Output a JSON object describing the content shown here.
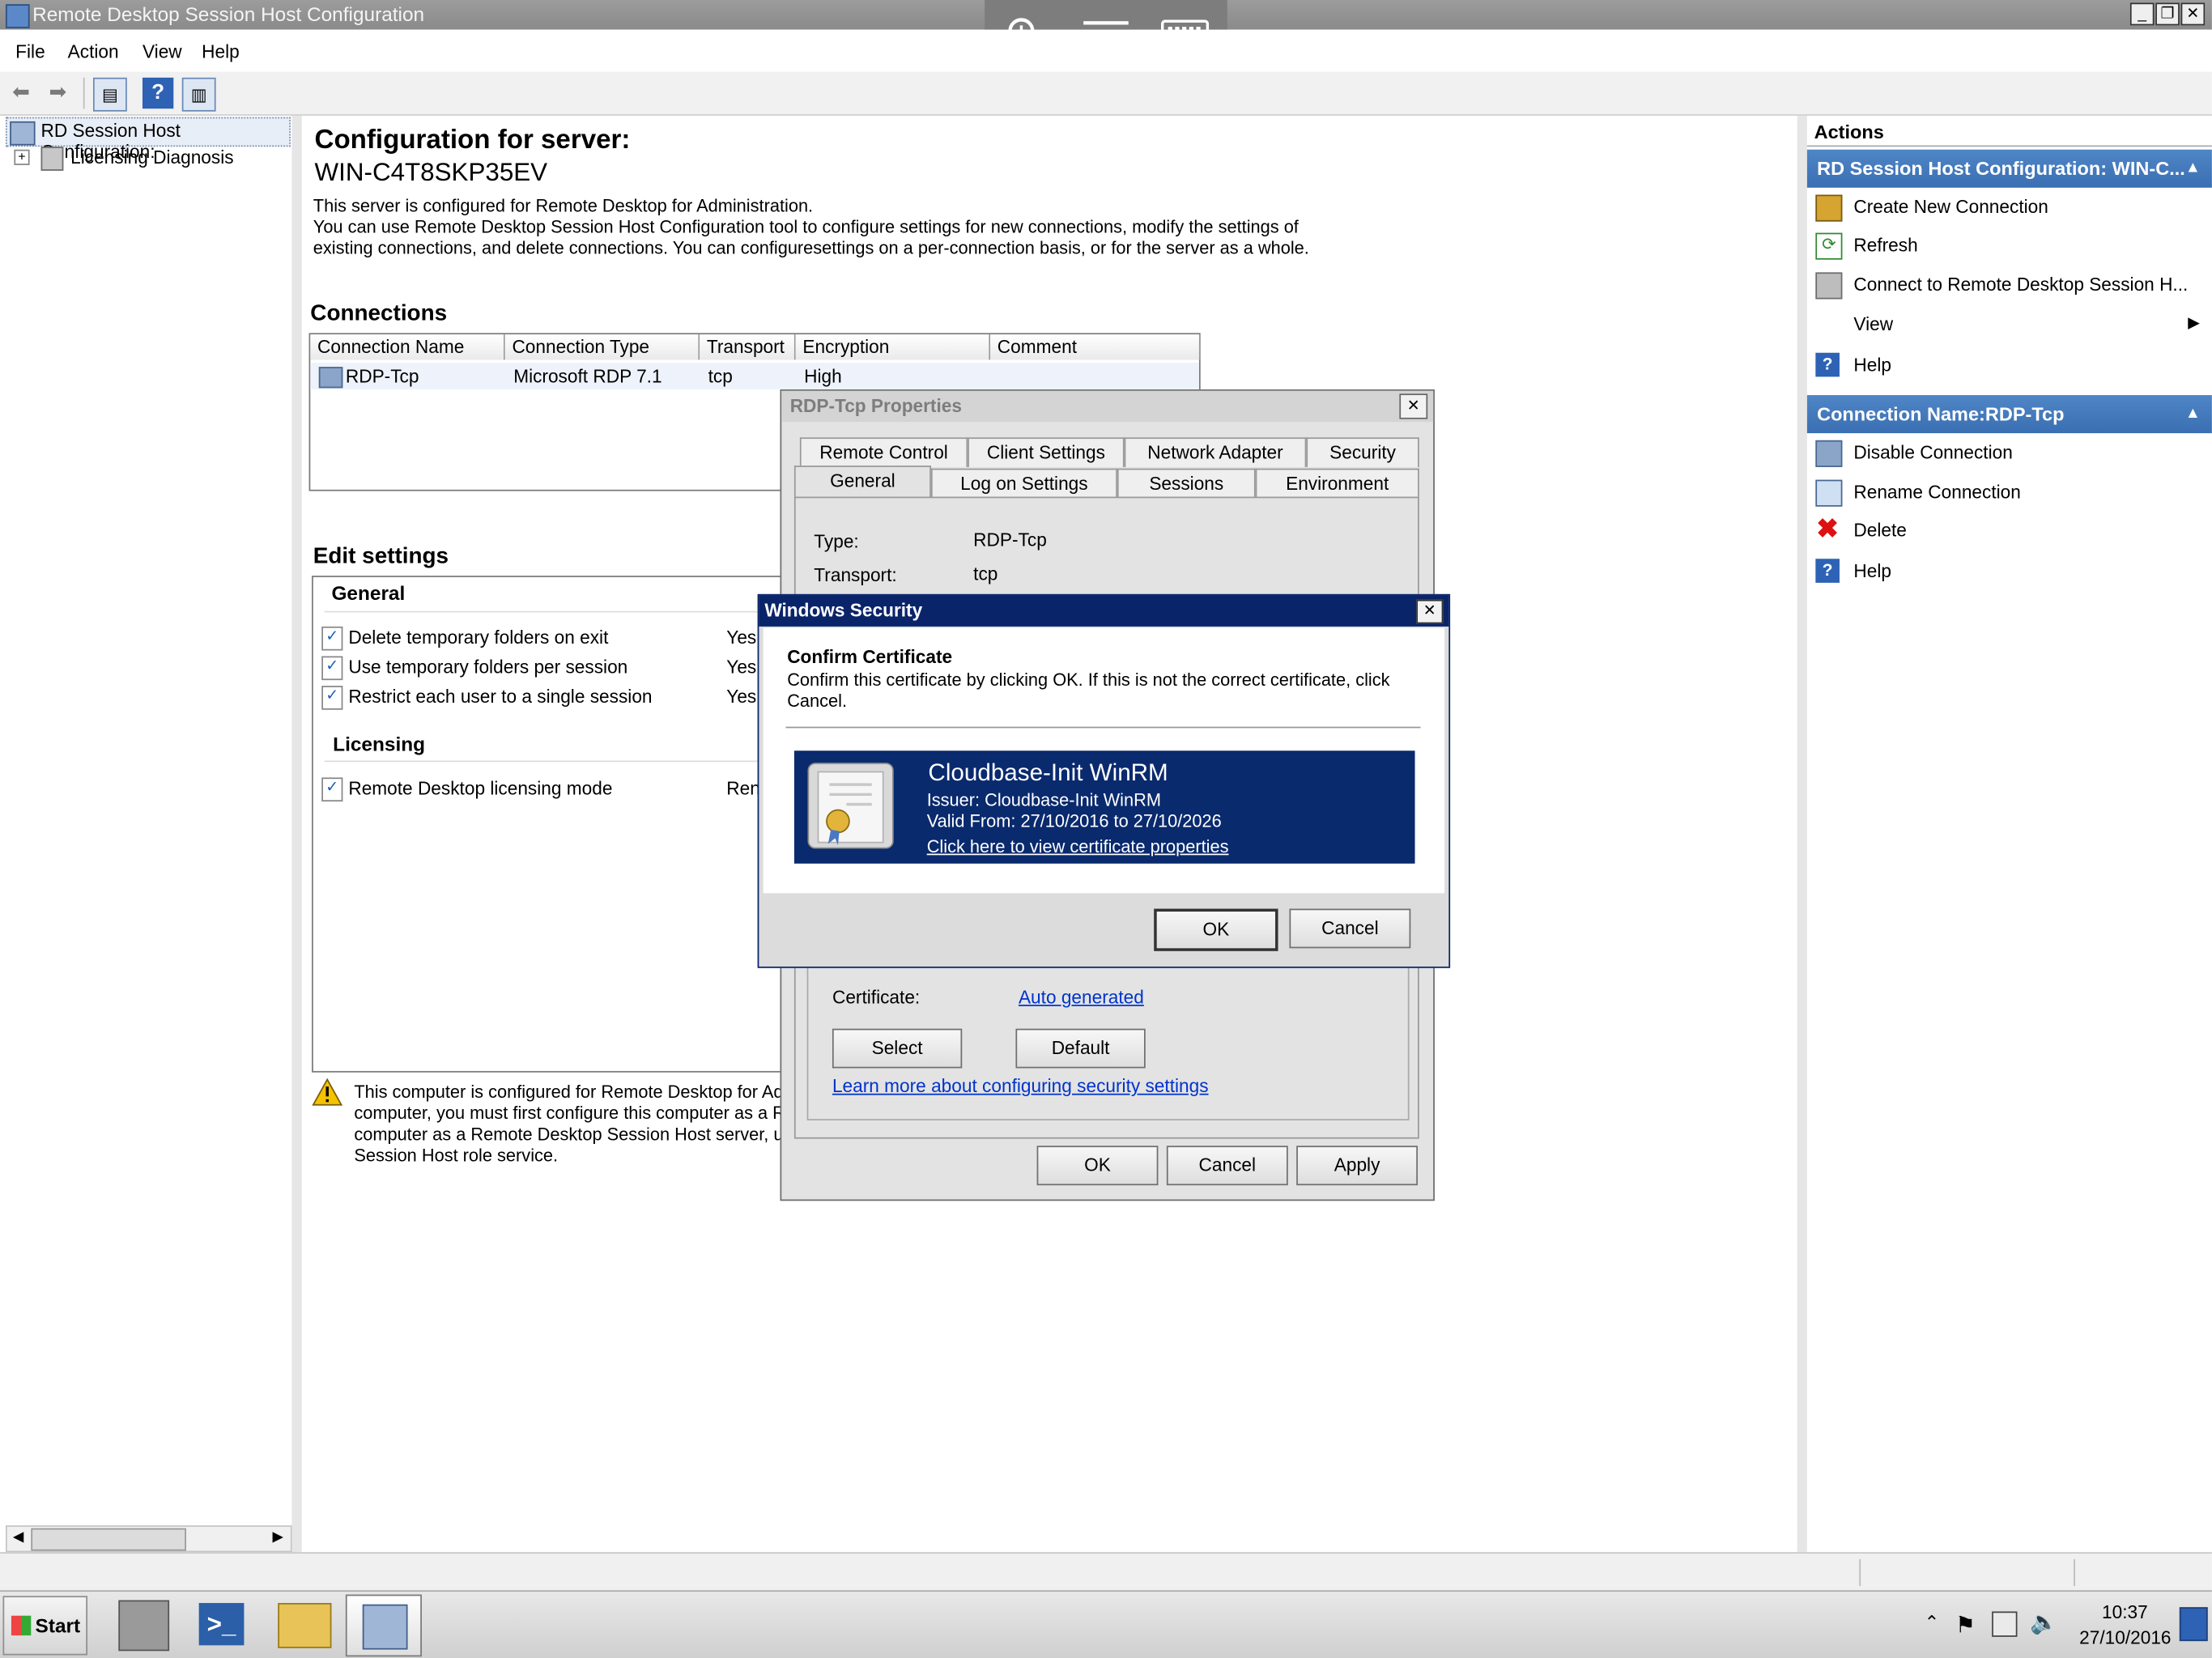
{
  "window": {
    "title": "Remote Desktop Session Host Configuration"
  },
  "menu": [
    "File",
    "Action",
    "View",
    "Help"
  ],
  "tree": {
    "root": "RD Session Host Configuration:",
    "child": "Licensing Diagnosis"
  },
  "main": {
    "title": "Configuration for server:",
    "server": "WIN-C4T8SKP35EV",
    "desc1": "This server is configured for Remote Desktop for Administration.",
    "desc2": "You can use Remote Desktop Session Host Configuration tool to configure settings for new connections, modify the settings of",
    "desc3": "existing connections, and delete connections. You can configuresettings on a per-connection basis, or for the server as a whole.",
    "connections_heading": "Connections",
    "columns": [
      "Connection Name",
      "Connection Type",
      "Transport",
      "Encryption",
      "Comment"
    ],
    "row": {
      "name": "RDP-Tcp",
      "type": "Microsoft RDP 7.1",
      "transport": "tcp",
      "encryption": "High",
      "comment": ""
    },
    "edit_heading": "Edit settings",
    "general": "General",
    "settings": [
      {
        "label": "Delete temporary folders on exit",
        "value": "Yes"
      },
      {
        "label": "Use temporary folders per session",
        "value": "Yes"
      },
      {
        "label": "Restrict each user to a single session",
        "value": "Yes"
      }
    ],
    "licensing": "Licensing",
    "licensing_setting": {
      "label": "Remote Desktop licensing mode",
      "value": "Ren"
    },
    "warning1": "This computer is configured for Remote Desktop for Adn",
    "warning2": "computer, you must first configure this computer as a Re",
    "warning3": "computer as a Remote Desktop Session Host server, us",
    "warning4": "Session Host role service."
  },
  "actions": {
    "title": "Actions",
    "section1": "RD Session Host Configuration: WIN-C...",
    "items1": [
      "Create New Connection",
      "Refresh",
      "Connect to Remote Desktop Session H...",
      "View",
      "Help"
    ],
    "section2": "Connection Name:RDP-Tcp",
    "items2": [
      "Disable Connection",
      "Rename Connection",
      "Delete",
      "Help"
    ]
  },
  "props": {
    "title": "RDP-Tcp Properties",
    "tabs_row1": [
      "Remote Control",
      "Client Settings",
      "Network Adapter",
      "Security"
    ],
    "tabs_row2": [
      "General",
      "Log on Settings",
      "Sessions",
      "Environment"
    ],
    "type_label": "Type:",
    "type_value": "RDP-Tcp",
    "transport_label": "Transport:",
    "transport_value": "tcp",
    "cert_label": "Certificate:",
    "cert_value": "Auto generated",
    "select": "Select",
    "default": "Default",
    "learn": "Learn more about configuring security settings",
    "ok": "OK",
    "cancel": "Cancel",
    "apply": "Apply"
  },
  "security": {
    "title": "Windows Security",
    "heading": "Confirm Certificate",
    "text1": "Confirm this certificate by clicking OK. If this is not the correct certificate, click",
    "text2": "Cancel.",
    "cert_name": "Cloudbase-Init WinRM",
    "issuer": "Issuer: Cloudbase-Init WinRM",
    "valid": "Valid From: 27/10/2016 to 27/10/2026",
    "view_link": "Click here to view certificate properties",
    "ok": "OK",
    "cancel": "Cancel"
  },
  "taskbar": {
    "start": "Start",
    "time": "10:37",
    "date": "27/10/2016"
  },
  "colors": {
    "accent": "#3a6fb3",
    "cert_bg": "#0a2a6e",
    "security_title": "#0a246a"
  }
}
